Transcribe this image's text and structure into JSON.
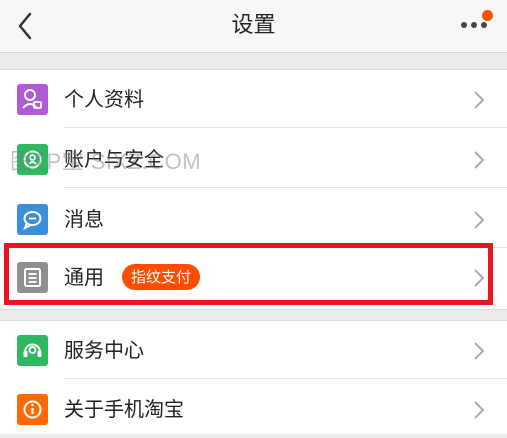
{
  "header": {
    "title": "设置"
  },
  "group1": [
    {
      "label": "个人资料",
      "icon": "profile-icon",
      "color": "#b05ad4"
    },
    {
      "label": "账户与安全",
      "icon": "account-security-icon",
      "color": "#2eb960"
    },
    {
      "label": "消息",
      "icon": "message-icon",
      "color": "#3c8ed8"
    },
    {
      "label": "通用",
      "icon": "general-icon",
      "color": "#8f8f8f",
      "tag": "指纹支付"
    }
  ],
  "group2": [
    {
      "label": "服务中心",
      "icon": "service-icon",
      "color": "#2eb960"
    },
    {
      "label": "关于手机淘宝",
      "icon": "info-icon",
      "color": "#ff6a00"
    }
  ],
  "watermark": "图TP宝 SIXZ.COM",
  "colors": {
    "accent": "#ff5000",
    "highlight": "#e8141e"
  }
}
